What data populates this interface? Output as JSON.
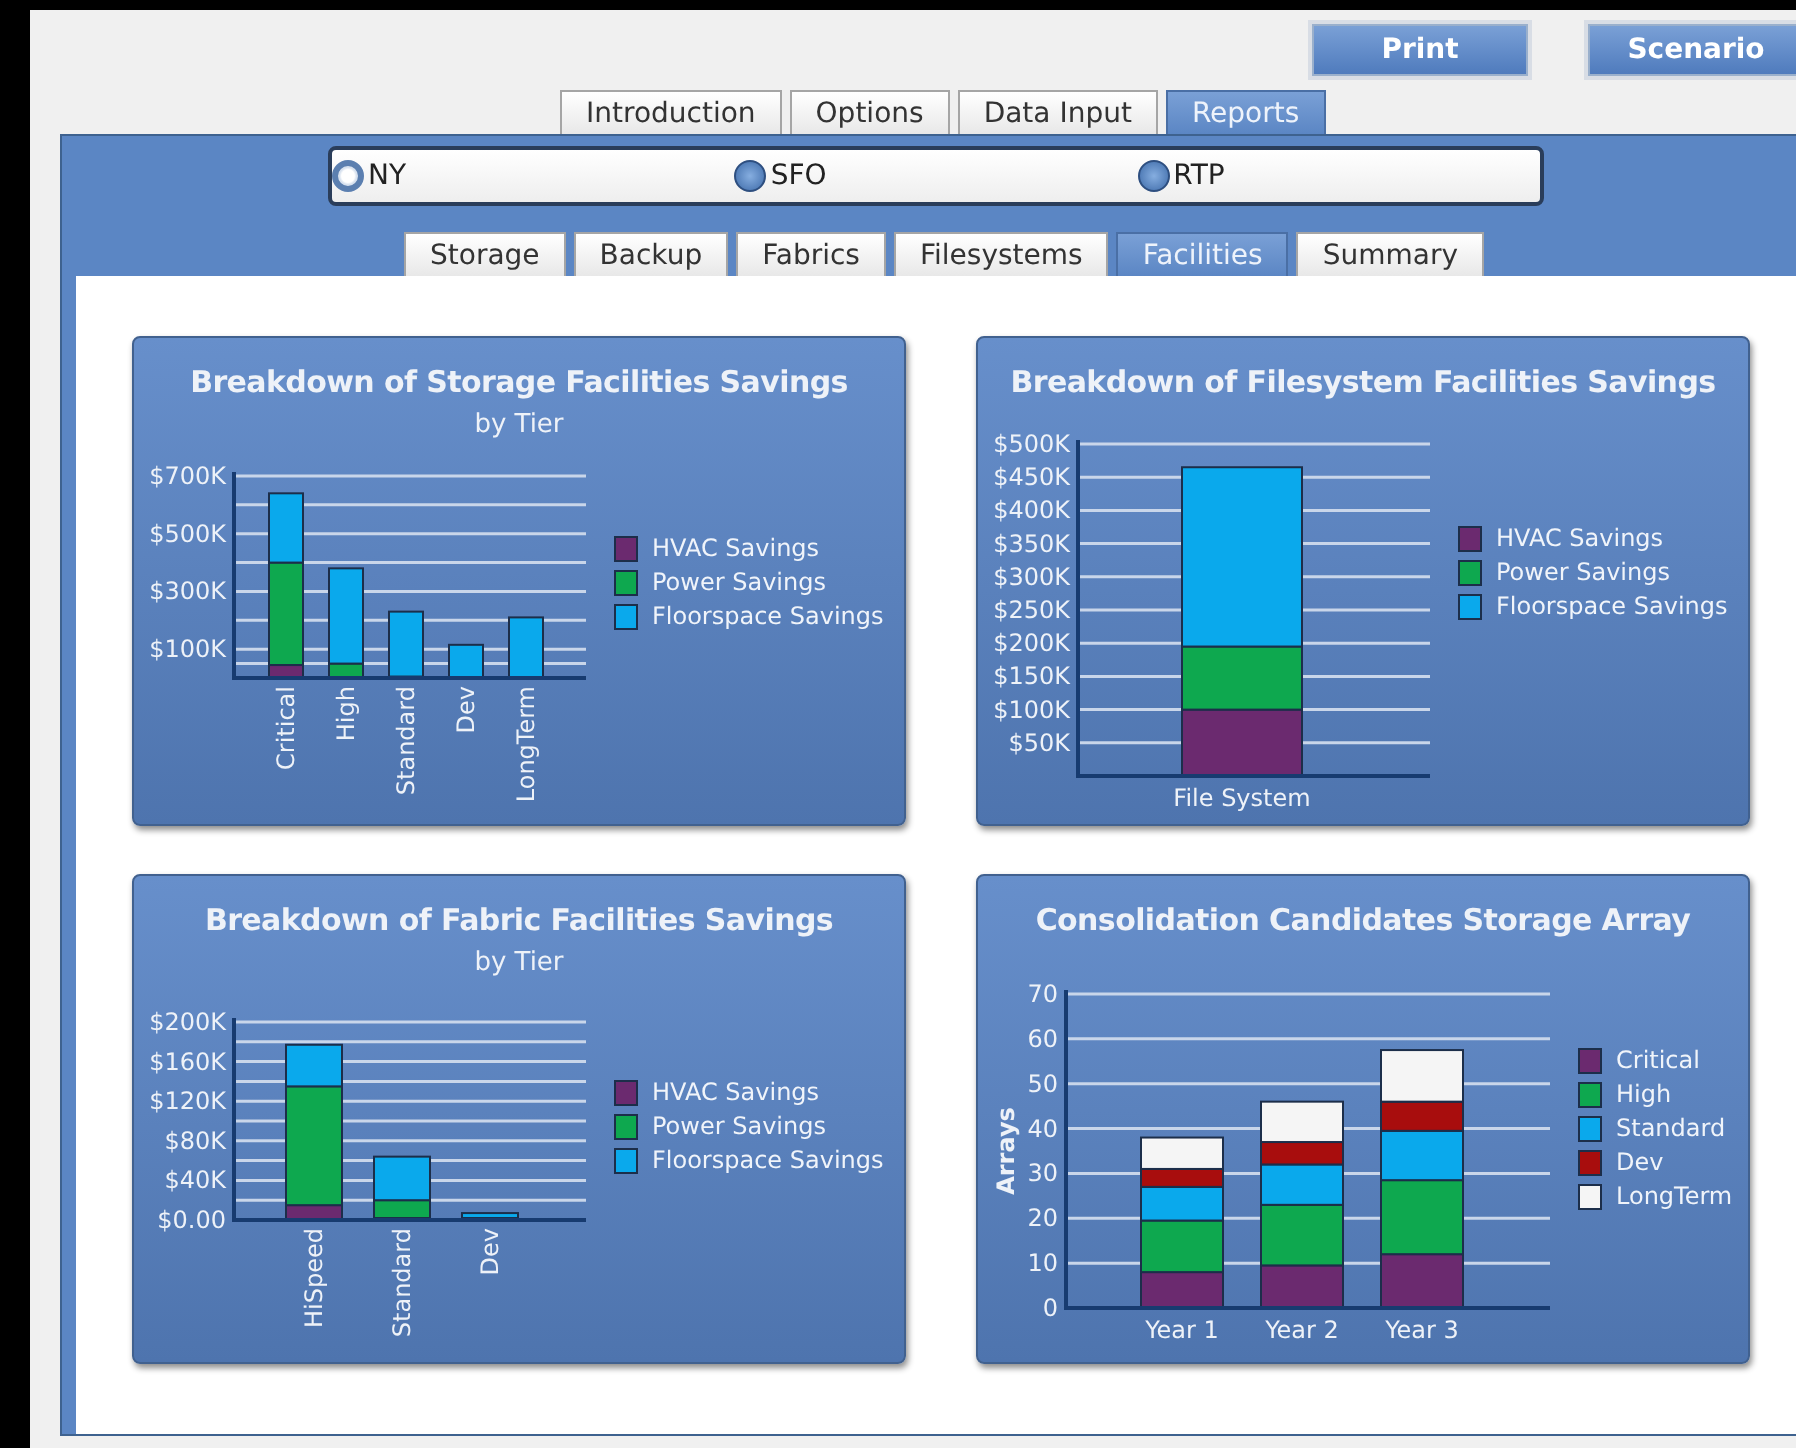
{
  "top_buttons": [
    "Print",
    "Scenario"
  ],
  "tabs": [
    {
      "label": "Introduction",
      "selected": false
    },
    {
      "label": "Options",
      "selected": false
    },
    {
      "label": "Data Input",
      "selected": false
    },
    {
      "label": "Reports",
      "selected": true
    }
  ],
  "sites": [
    {
      "label": "NY",
      "selected": true
    },
    {
      "label": "SFO",
      "selected": false
    },
    {
      "label": "RTP",
      "selected": false
    }
  ],
  "subtabs": [
    {
      "label": "Storage",
      "selected": false
    },
    {
      "label": "Backup",
      "selected": false
    },
    {
      "label": "Fabrics",
      "selected": false
    },
    {
      "label": "Filesystems",
      "selected": false
    },
    {
      "label": "Facilities",
      "selected": true
    },
    {
      "label": "Summary",
      "selected": false
    }
  ],
  "cards": [
    {
      "subtitle": "by Tier",
      "chart_data": {
        "type": "bar",
        "title": "Breakdown of Storage Facilities Savings",
        "stacked": true,
        "grid": true,
        "categories": [
          "Critical",
          "High",
          "Standard",
          "Dev",
          "LongTerm"
        ],
        "ylim": [
          0,
          700000
        ],
        "yticks": [
          {
            "value": 100000,
            "label": "$100K"
          },
          {
            "value": 300000,
            "label": "$300K"
          },
          {
            "value": 500000,
            "label": "$500K"
          },
          {
            "value": 700000,
            "label": "$700K"
          }
        ],
        "series": [
          {
            "name": "HVAC Savings",
            "color": "#6b2a6f",
            "values": [
              45000,
              0,
              5000,
              0,
              0
            ]
          },
          {
            "name": "Power Savings",
            "color": "#0ea84f",
            "values": [
              355000,
              50000,
              0,
              0,
              0
            ]
          },
          {
            "name": "Floorspace Savings",
            "color": "#0aa9ec",
            "values": [
              240000,
              330000,
              225000,
              115000,
              210000
            ]
          }
        ]
      }
    },
    {
      "chart_data": {
        "type": "bar",
        "title": "Breakdown of Filesystem Facilities Savings",
        "stacked": true,
        "grid": true,
        "categories": [
          "File System"
        ],
        "ylim": [
          0,
          500000
        ],
        "yticks": [
          {
            "value": 50000,
            "label": "$50K"
          },
          {
            "value": 100000,
            "label": "$100K"
          },
          {
            "value": 150000,
            "label": "$150K"
          },
          {
            "value": 200000,
            "label": "$200K"
          },
          {
            "value": 250000,
            "label": "$250K"
          },
          {
            "value": 300000,
            "label": "$300K"
          },
          {
            "value": 350000,
            "label": "$350K"
          },
          {
            "value": 400000,
            "label": "$400K"
          },
          {
            "value": 450000,
            "label": "$450K"
          },
          {
            "value": 500000,
            "label": "$500K"
          }
        ],
        "series": [
          {
            "name": "HVAC Savings",
            "color": "#6b2a6f",
            "values": [
              100000
            ]
          },
          {
            "name": "Power Savings",
            "color": "#0ea84f",
            "values": [
              95000
            ]
          },
          {
            "name": "Floorspace Savings",
            "color": "#0aa9ec",
            "values": [
              270000
            ]
          }
        ]
      }
    },
    {
      "subtitle": "by Tier",
      "chart_data": {
        "type": "bar",
        "title": "Breakdown of Fabric Facilities Savings",
        "stacked": true,
        "grid": true,
        "categories": [
          "HiSpeed",
          "Standard",
          "Dev"
        ],
        "ylim": [
          0,
          200000
        ],
        "yticks": [
          {
            "value": 0,
            "label": "$0.00"
          },
          {
            "value": 40000,
            "label": "$40K"
          },
          {
            "value": 80000,
            "label": "$80K"
          },
          {
            "value": 120000,
            "label": "$120K"
          },
          {
            "value": 160000,
            "label": "$160K"
          },
          {
            "value": 200000,
            "label": "$200K"
          }
        ],
        "series": [
          {
            "name": "HVAC Savings",
            "color": "#6b2a6f",
            "values": [
              15000,
              2000,
              1000
            ]
          },
          {
            "name": "Power Savings",
            "color": "#0ea84f",
            "values": [
              120000,
              18000,
              1000
            ]
          },
          {
            "name": "Floorspace Savings",
            "color": "#0aa9ec",
            "values": [
              42000,
              44000,
              5000
            ]
          }
        ]
      }
    },
    {
      "chart_data": {
        "type": "bar",
        "title": "Consolidation Candidates Storage Array",
        "ylabel": "Arrays",
        "stacked": true,
        "grid": true,
        "categories": [
          "Year 1",
          "Year 2",
          "Year 3"
        ],
        "ylim": [
          0,
          70
        ],
        "yticks": [
          0,
          10,
          20,
          30,
          40,
          50,
          60,
          70
        ],
        "series": [
          {
            "name": "Critical",
            "color": "#6b2a6f",
            "values": [
              8,
              9.5,
              12
            ]
          },
          {
            "name": "High",
            "color": "#0ea84f",
            "values": [
              11.5,
              13.5,
              16.5
            ]
          },
          {
            "name": "Standard",
            "color": "#0aa9ec",
            "values": [
              7.5,
              9,
              11
            ]
          },
          {
            "name": "Dev",
            "color": "#a80d0d",
            "values": [
              4,
              5,
              6.5
            ]
          },
          {
            "name": "LongTerm",
            "color": "#f5f5f5",
            "values": [
              7,
              9,
              11.5
            ]
          }
        ]
      }
    }
  ]
}
